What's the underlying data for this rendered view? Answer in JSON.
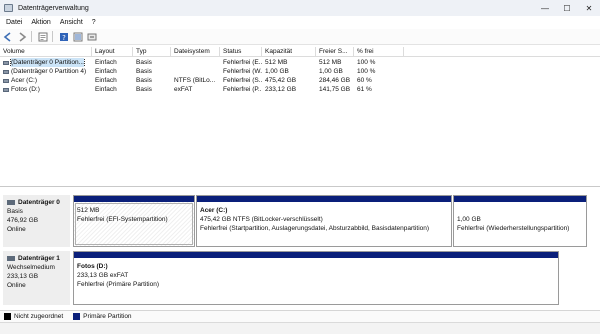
{
  "window": {
    "title": "Datenträgerverwaltung",
    "minimize": "—",
    "maximize": "☐",
    "close": "✕"
  },
  "menu": [
    "Datei",
    "Aktion",
    "Ansicht",
    "?"
  ],
  "toolbar": [
    "arrow-left-icon",
    "arrow-right-icon",
    "properties-icon",
    "help-icon",
    "list-icon",
    "refresh-icon"
  ],
  "volumes": {
    "headers": [
      "Volume",
      "Layout",
      "Typ",
      "Dateisystem",
      "Status",
      "Kapazität",
      "Freier S...",
      "% frei"
    ],
    "rows": [
      [
        "(Datenträger 0 Partition...",
        "Einfach",
        "Basis",
        "",
        "Fehlerfrei (E...",
        "512 MB",
        "512 MB",
        "100 %"
      ],
      [
        "(Datenträger 0 Partition 4)",
        "Einfach",
        "Basis",
        "",
        "Fehlerfrei (W...",
        "1,00 GB",
        "1,00 GB",
        "100 %"
      ],
      [
        "Acer (C:)",
        "Einfach",
        "Basis",
        "NTFS (BitLo...",
        "Fehlerfrei (S...",
        "475,42 GB",
        "284,46 GB",
        "60 %"
      ],
      [
        "Fotos (D:)",
        "Einfach",
        "Basis",
        "exFAT",
        "Fehlerfrei (P...",
        "233,12 GB",
        "141,75 GB",
        "61 %"
      ]
    ]
  },
  "disks": [
    {
      "name": "Datenträger 0",
      "type": "Basis",
      "size": "476,92 GB",
      "state": "Online",
      "partitions": [
        {
          "title": "",
          "line1": "512 MB",
          "line2": "Fehlerfrei (EFI-Systempartition)"
        },
        {
          "title": "Acer  (C:)",
          "line1": "475,42 GB NTFS (BitLocker-verschlüsselt)",
          "line2": "Fehlerfrei (Startpartition, Auslagerungsdatei, Absturzabbild, Basisdatenpartition)"
        },
        {
          "title": "",
          "line1": "1,00 GB",
          "line2": "Fehlerfrei (Wiederherstellungspartition)"
        }
      ]
    },
    {
      "name": "Datenträger 1",
      "type": "Wechselmedium",
      "size": "233,13 GB",
      "state": "Online",
      "partitions": [
        {
          "title": "Fotos  (D:)",
          "line1": "233,13 GB exFAT",
          "line2": "Fehlerfrei (Primäre Partition)"
        }
      ]
    }
  ],
  "legend": [
    {
      "label": "Nicht zugeordnet",
      "color": "#000000"
    },
    {
      "label": "Primäre Partition",
      "color": "#0a1f7a"
    }
  ]
}
